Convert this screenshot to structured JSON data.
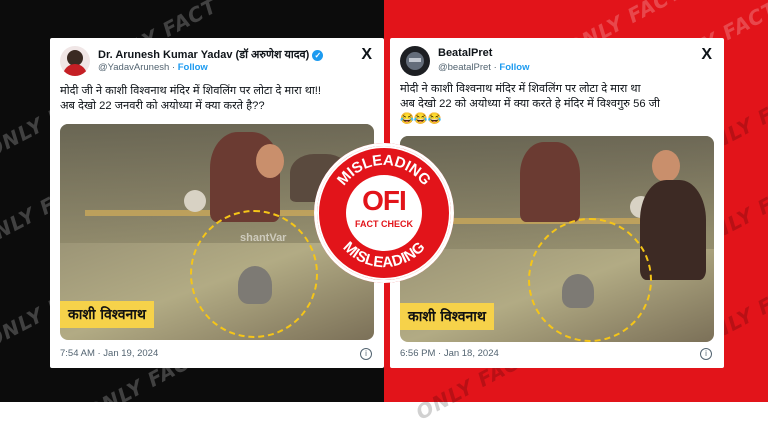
{
  "watermark": "ONLY FACT",
  "colors": {
    "left_bg": "#0c0c0c",
    "right_bg": "#e2141a",
    "accent": "#1d9bf0",
    "caption_bg": "#f6d24a"
  },
  "tweets": [
    {
      "display_name": "Dr. Arunesh Kumar Yadav (डॉ अरुणेश यादव)",
      "verified": true,
      "handle": "@YadavArunesh",
      "separator": "·",
      "follow_label": "Follow",
      "x_icon": "X",
      "text_lines": [
        "मोदी जी ने काशी विश्वनाथ मंदिर में शिवलिंग पर लोटा दे मारा था!!",
        "अब देखो 22 जनवरी को अयोध्या में क्या  करते है??"
      ],
      "media_caption": "काशी विश्वनाथ",
      "media_watermark": "shantVar",
      "timestamp": "7:54 AM · Jan 19, 2024",
      "info_icon": "i"
    },
    {
      "display_name": "BeatalPret",
      "verified": false,
      "handle": "@beatalPret",
      "separator": "·",
      "follow_label": "Follow",
      "x_icon": "X",
      "text_lines": [
        "मोदी ने काशी विश्वनाथ मंदिर में शिवलिंग पर लोटा दे मारा था",
        "अब देखो 22 को अयोध्या में क्या  करते हे मंदिर में  विश्वगुरु 56 जी",
        "😂😂😂"
      ],
      "media_caption": "काशी विश्वनाथ",
      "timestamp": "6:56 PM · Jan 18, 2024",
      "info_icon": "i"
    }
  ],
  "stamp": {
    "top_text": "MISLEADING",
    "bottom_text": "MISLEADING",
    "logo": "OFI",
    "subtitle": "FACT CHECK"
  }
}
